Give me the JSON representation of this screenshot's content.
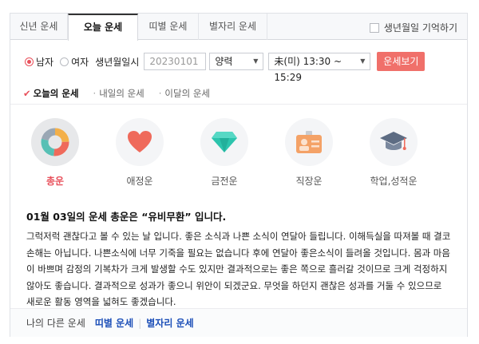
{
  "tabs": [
    {
      "label": "신년 운세"
    },
    {
      "label": "오늘 운세"
    },
    {
      "label": "띠별 운세"
    },
    {
      "label": "별자리 운세"
    }
  ],
  "remember_label": "생년월일 기억하기",
  "form": {
    "gender_male": "남자",
    "gender_female": "여자",
    "birth_label": "생년월일시",
    "birth_placeholder": "20230101",
    "calendar_value": "양력",
    "time_value": "未(미) 13:30 ~ 15:29",
    "submit_label": "운세보기"
  },
  "subtabs": [
    {
      "label": "오늘의 운세"
    },
    {
      "label": "내일의 운세"
    },
    {
      "label": "이달의 운세"
    }
  ],
  "categories": [
    {
      "label": "총운",
      "icon": "pie-chart-icon"
    },
    {
      "label": "애정운",
      "icon": "heart-icon"
    },
    {
      "label": "금전운",
      "icon": "diamond-icon"
    },
    {
      "label": "직장운",
      "icon": "id-card-icon"
    },
    {
      "label": "학업,성적운",
      "icon": "graduation-cap-icon"
    }
  ],
  "fortune": {
    "headline": "01월 03일의 운세 총운은 “유비무환” 입니다.",
    "body": "그럭저럭 괜찮다고 볼 수 있는 날 입니다. 좋은 소식과 나쁜 소식이 연달아 들립니다. 이해득실을 따져볼 때 결코 손해는 아닙니다. 나쁜소식에 너무 기죽을 필요는 없습니다 후에 연달아 좋은소식이 들려올 것입니다. 몸과 마음이 바쁘며 감정의 기복차가 크게 발생할 수도 있지만 결과적으로는 좋은 쪽으로 흘러갈 것이므로 크게 걱정하지 않아도 좋습니다. 결과적으로 성과가 좋으니 위안이 되겠군요. 무엇을 하던지 괜찮은 성과를 거둘 수 있으므로 새로운 활동 영역을 넓혀도 좋겠습니다."
  },
  "footer": {
    "label": "나의 다른 운세",
    "link1": "띠별 운세",
    "link2": "별자리 운세"
  },
  "colors": {
    "accent": "#e8505b",
    "button": "#f0706a",
    "link": "#1c4fb8"
  }
}
